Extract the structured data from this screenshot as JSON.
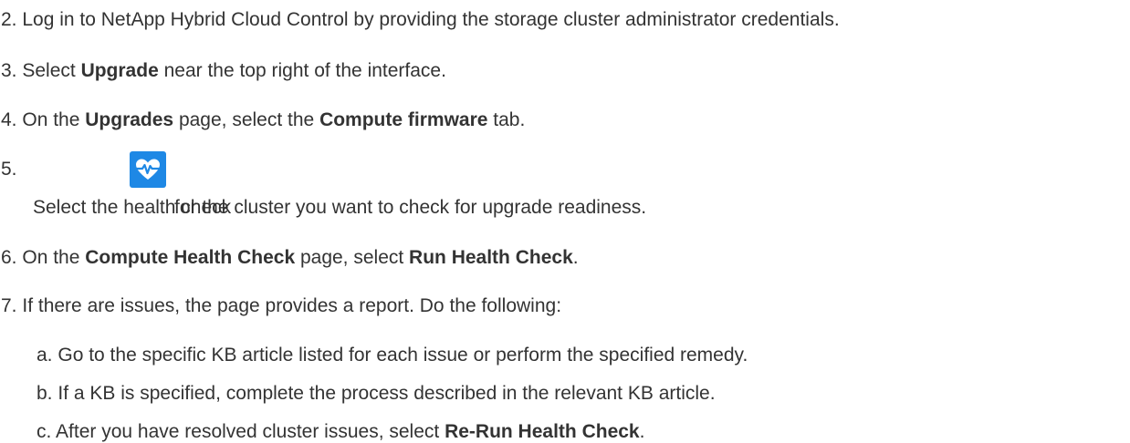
{
  "steps": [
    {
      "num": "2.",
      "text": "Log in to NetApp Hybrid Cloud Control by providing the storage cluster administrator credentials."
    },
    {
      "num": "3.",
      "pre": "Select ",
      "bold1": "Upgrade",
      "post": " near the top right of the interface."
    },
    {
      "num": "4.",
      "pre": "On the ",
      "bold1": "Upgrades",
      "mid": " page, select the ",
      "bold2": "Compute firmware",
      "post": " tab."
    },
    {
      "num": "5.",
      "pre": "Select the health check",
      "post": "for the cluster you want to check for upgrade readiness.",
      "icon": "heart-pulse-icon"
    },
    {
      "num": "6.",
      "pre": "On the ",
      "bold1": "Compute Health Check",
      "mid": " page, select ",
      "bold2": "Run Health Check",
      "post": "."
    },
    {
      "num": "7.",
      "text": "If there are issues, the page provides a report. Do the following:"
    }
  ],
  "substeps": [
    {
      "letter": "a.",
      "text": "Go to the specific KB article listed for each issue or perform the specified remedy."
    },
    {
      "letter": "b.",
      "text": "If a KB is specified, complete the process described in the relevant KB article."
    },
    {
      "letter": "c.",
      "pre": "After you have resolved cluster issues, select ",
      "bold1": "Re-Run Health Check",
      "post": "."
    }
  ],
  "colors": {
    "icon_bg": "#1e88e5",
    "text": "#333333"
  }
}
